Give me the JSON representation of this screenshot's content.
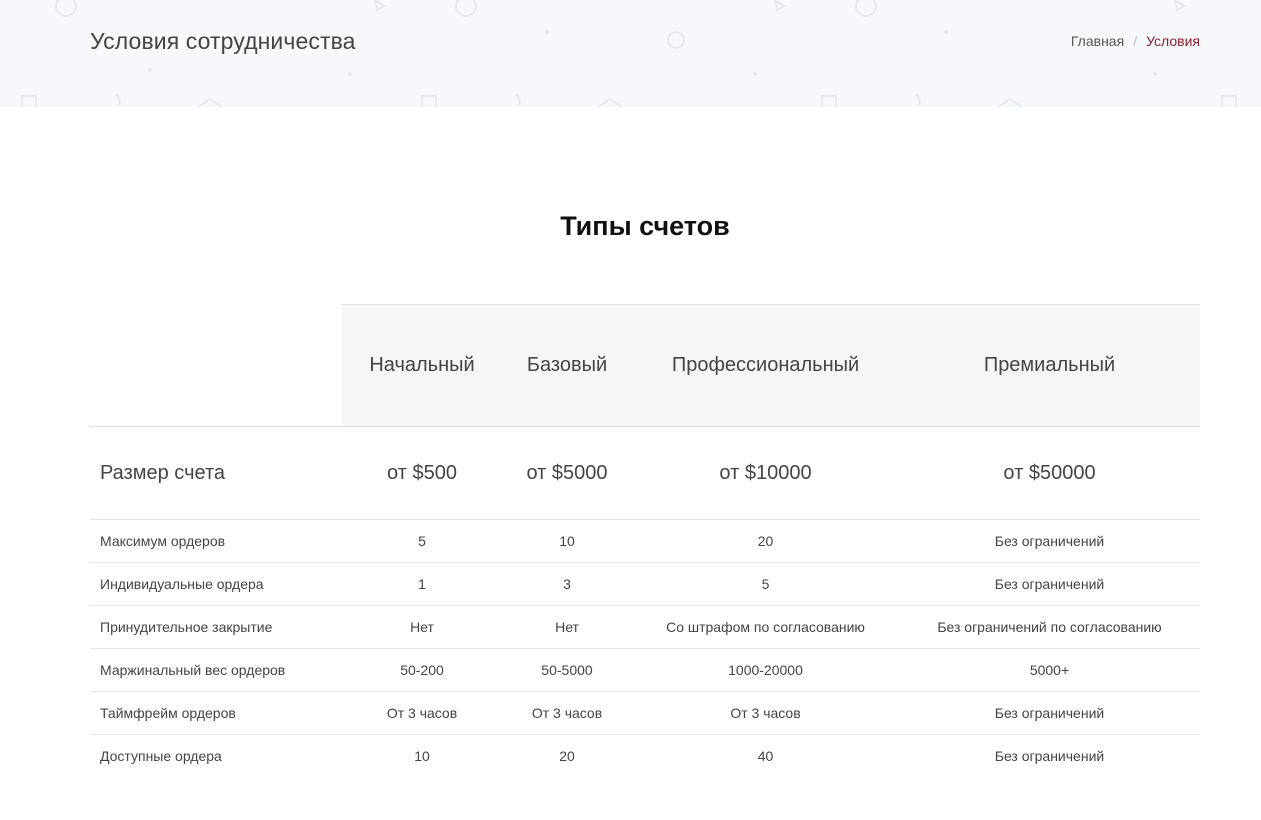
{
  "header": {
    "title": "Условия сотрудничества",
    "breadcrumb": {
      "home": "Главная",
      "separator": "/",
      "current": "Условия"
    }
  },
  "section_title": "Типы счетов",
  "table": {
    "columns": [
      "Начальный",
      "Базовый",
      "Профессиональный",
      "Премиальный"
    ],
    "size_row": {
      "label": "Размер счета",
      "values": [
        "от $500",
        "от $5000",
        "от $10000",
        "от $50000"
      ]
    },
    "rows": [
      {
        "label": "Максимум ордеров",
        "values": [
          "5",
          "10",
          "20",
          "Без ограничений"
        ]
      },
      {
        "label": "Индивидуальные ордера",
        "values": [
          "1",
          "3",
          "5",
          "Без ограничений"
        ]
      },
      {
        "label": "Принудительное закрытие",
        "values": [
          "Нет",
          "Нет",
          "Со штрафом по согласованию",
          "Без ограничений по согласованию"
        ]
      },
      {
        "label": "Маржинальный вес ордеров",
        "values": [
          "50-200",
          "50-5000",
          "1000-20000",
          "5000+"
        ]
      },
      {
        "label": "Таймфрейм ордеров",
        "values": [
          "От 3 часов",
          "От 3 часов",
          "От 3 часов",
          "Без ограничений"
        ]
      },
      {
        "label": "Доступные ордера",
        "values": [
          "10",
          "20",
          "40",
          "Без ограничений"
        ]
      }
    ]
  },
  "colors": {
    "header_bg": "#f6f8fb",
    "breadcrumb_active": "#8b1e2c",
    "table_head_bg": "#f6f6f6"
  }
}
